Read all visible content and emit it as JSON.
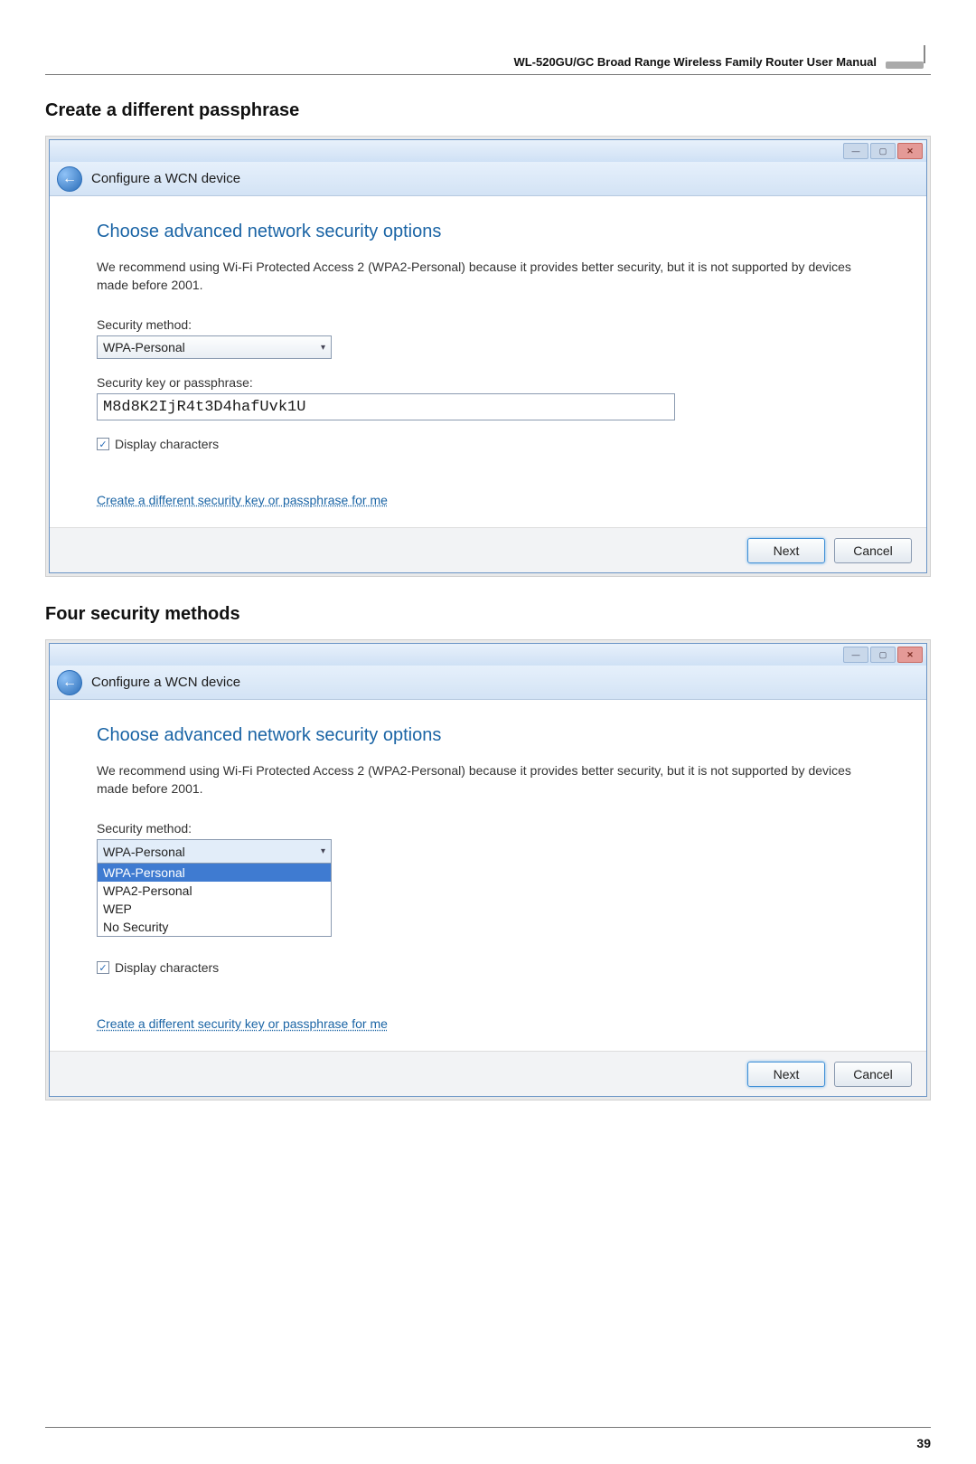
{
  "header": {
    "manual_title": "WL-520GU/GC Broad Range Wireless Family Router User Manual"
  },
  "section1": {
    "heading": "Create  a different passphrase",
    "window": {
      "nav_title": "Configure a WCN device",
      "wizard_title": "Choose advanced network security options",
      "description": "We recommend using Wi-Fi Protected Access 2 (WPA2-Personal) because it provides better security,  but it is not supported by devices made before 2001.",
      "security_method_label": "Security method:",
      "security_method_value": "WPA-Personal",
      "passphrase_label": "Security key or passphrase:",
      "passphrase_value": "M8d8K2IjR4t3D4hafUvk1U",
      "display_chars_label": "Display characters",
      "display_chars_checked": true,
      "link_text": "Create a different security key or passphrase for me",
      "next_label": "Next",
      "cancel_label": "Cancel"
    }
  },
  "section2": {
    "heading": "Four security methods",
    "window": {
      "nav_title": "Configure a WCN device",
      "wizard_title": "Choose advanced network security options",
      "description": "We recommend using Wi-Fi Protected Access 2 (WPA2-Personal) because it provides better security,  but it is not supported by devices made before 2001.",
      "security_method_label": "Security method:",
      "security_method_value": "WPA-Personal",
      "security_method_options": [
        "WPA-Personal",
        "WPA2-Personal",
        "WEP",
        "No Security"
      ],
      "display_chars_label": "Display characters",
      "display_chars_checked": true,
      "link_text": "Create a different security key or passphrase for me",
      "next_label": "Next",
      "cancel_label": "Cancel"
    }
  },
  "page_number": "39",
  "titlebar_buttons": {
    "minimize": "—",
    "maximize": "▢",
    "close": "✕"
  },
  "icons": {
    "back_arrow": "←",
    "caret": "▾",
    "check": "✓"
  }
}
